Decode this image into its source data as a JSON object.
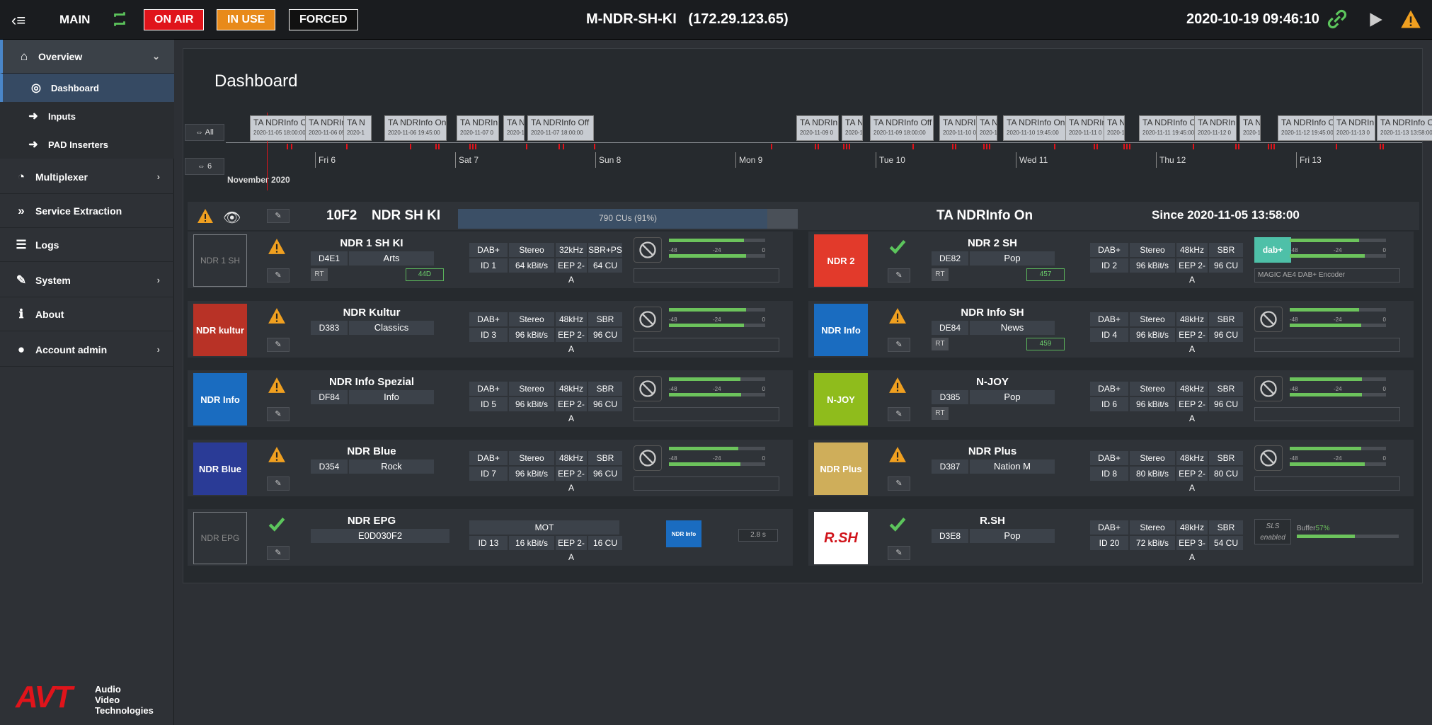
{
  "topbar": {
    "mode": "MAIN",
    "on_air": "ON AIR",
    "in_use": "IN USE",
    "forced": "FORCED",
    "host": "M-NDR-SH-KI   (172.29.123.65)",
    "datetime": "2020-10-19 09:46:10",
    "icons": [
      "menu-icon",
      "sync-icon",
      "link-icon",
      "play-icon",
      "warning-icon"
    ]
  },
  "sidebar": {
    "overview": "Overview",
    "dashboard": "Dashboard",
    "inputs": "Inputs",
    "pad": "PAD Inserters",
    "multiplexer": "Multiplexer",
    "service_extraction": "Service Extraction",
    "logs": "Logs",
    "system": "System",
    "about": "About",
    "account": "Account admin"
  },
  "logo": {
    "avt": "AVT",
    "line1": "Audio",
    "line2": "Video",
    "line3": "Technologies"
  },
  "dashboard": {
    "title": "Dashboard"
  },
  "timeline": {
    "all": "All",
    "six": "6",
    "month": "November 2020",
    "days": [
      "Fri 6",
      "Sat 7",
      "Sun 8",
      "Mon 9",
      "Tue 10",
      "Wed 11",
      "Thu 12",
      "Fri 13"
    ],
    "events": [
      {
        "t": "TA NDRInfo Off",
        "d": "2020-11-05 18:00:00"
      },
      {
        "t": "TA NDRInfo",
        "d": "2020-11-06 05:"
      },
      {
        "t": "TA N",
        "d": "2020-1"
      },
      {
        "t": "TA NDRInfo On",
        "d": "2020-11-06 19:45:00"
      },
      {
        "t": "TA NDRIn",
        "d": "2020-11-07 0"
      },
      {
        "t": "TA N",
        "d": "2020-1"
      },
      {
        "t": "TA NDRInfo Off",
        "d": "2020-11-07 18:00:00"
      },
      {
        "t": "TA NDRIn",
        "d": "2020-11-09 0"
      },
      {
        "t": "TA N",
        "d": "2020-1"
      },
      {
        "t": "TA NDRInfo Off",
        "d": "2020-11-09 18:00:00"
      },
      {
        "t": "TA NDRIn",
        "d": "2020-11-10 0"
      },
      {
        "t": "TA N",
        "d": "2020-1"
      },
      {
        "t": "TA NDRInfo On",
        "d": "2020-11-10 19:45:00"
      },
      {
        "t": "TA NDRIn",
        "d": "2020-11-11 0"
      },
      {
        "t": "TA N",
        "d": "2020-1"
      },
      {
        "t": "TA NDRInfo On",
        "d": "2020-11-11 19:45:00"
      },
      {
        "t": "TA NDRIn",
        "d": "2020-11-12 0"
      },
      {
        "t": "TA N",
        "d": "2020-1"
      },
      {
        "t": "TA NDRInfo On",
        "d": "2020-11-12 19:45:00"
      },
      {
        "t": "TA NDRIn",
        "d": "2020-11-13 0"
      },
      {
        "t": "TA NDRInfo On",
        "d": "2020-11-13 13:58:00"
      }
    ]
  },
  "ensemble": {
    "id": "10F2",
    "name": "NDR SH KI",
    "cu_label": "790 CUs (91%)",
    "cu_fraction": 0.91,
    "ta": "TA NDRInfo On",
    "since": "Since 2020-11-05 13:58:00"
  },
  "services": [
    {
      "logo": "NDR 1 SH",
      "name": "NDR 1 SH KI",
      "sid": "D4E1",
      "pty": "Arts",
      "rt": "RT",
      "pi": "44D",
      "c": [
        "DAB+",
        "Stereo",
        "32kHz",
        "SBR+PS",
        "ID 1",
        "64 kBit/s",
        "EEP 2-A",
        "64 CU"
      ],
      "txt": "",
      "ok": false
    },
    {
      "logo": "NDR 2",
      "name": "NDR 2 SH",
      "sid": "DE82",
      "pty": "Pop",
      "rt": "RT",
      "pi": "457",
      "c": [
        "DAB+",
        "Stereo",
        "48kHz",
        "SBR",
        "ID 2",
        "96 kBit/s",
        "EEP 2-A",
        "96 CU"
      ],
      "txt": "MAGIC AE4 DAB+ Encoder",
      "ok": true
    },
    {
      "logo": "NDR kultur",
      "name": "NDR Kultur",
      "sid": "D383",
      "pty": "Classics",
      "rt": "",
      "pi": "",
      "c": [
        "DAB+",
        "Stereo",
        "48kHz",
        "SBR",
        "ID 3",
        "96 kBit/s",
        "EEP 2-A",
        "96 CU"
      ],
      "txt": "",
      "ok": false
    },
    {
      "logo": "NDR Info",
      "name": "NDR Info SH",
      "sid": "DE84",
      "pty": "News",
      "rt": "RT",
      "pi": "459",
      "c": [
        "DAB+",
        "Stereo",
        "48kHz",
        "SBR",
        "ID 4",
        "96 kBit/s",
        "EEP 2-A",
        "96 CU"
      ],
      "txt": "",
      "ok": false
    },
    {
      "logo": "NDR Info",
      "name": "NDR Info Spezial",
      "sid": "DF84",
      "pty": "Info",
      "rt": "",
      "pi": "",
      "c": [
        "DAB+",
        "Stereo",
        "48kHz",
        "SBR",
        "ID 5",
        "96 kBit/s",
        "EEP 2-A",
        "96 CU"
      ],
      "txt": "",
      "ok": false
    },
    {
      "logo": "N-JOY",
      "name": "N-JOY",
      "sid": "D385",
      "pty": "Pop",
      "rt": "RT",
      "pi": "",
      "c": [
        "DAB+",
        "Stereo",
        "48kHz",
        "SBR",
        "ID 6",
        "96 kBit/s",
        "EEP 2-A",
        "96 CU"
      ],
      "txt": "",
      "ok": false
    },
    {
      "logo": "NDR Blue",
      "name": "NDR Blue",
      "sid": "D354",
      "pty": "Rock",
      "rt": "",
      "pi": "",
      "c": [
        "DAB+",
        "Stereo",
        "48kHz",
        "SBR",
        "ID 7",
        "96 kBit/s",
        "EEP 2-A",
        "96 CU"
      ],
      "txt": "",
      "ok": false
    },
    {
      "logo": "NDR Plus",
      "name": "NDR Plus",
      "sid": "D387",
      "pty": "Nation M",
      "rt": "",
      "pi": "",
      "c": [
        "DAB+",
        "Stereo",
        "48kHz",
        "SBR",
        "ID 8",
        "80 kBit/s",
        "EEP 2-A",
        "80 CU"
      ],
      "txt": "",
      "ok": false
    },
    {
      "logo": "NDR EPG",
      "name": "NDR EPG",
      "sid": "E0D030F2",
      "pty": "",
      "rt": "",
      "pi": "",
      "c": [
        "MOT",
        "ID 13",
        "16 kBit/s",
        "EEP 2-A",
        "16 CU"
      ],
      "txt": "2.8 s",
      "ok": true
    },
    {
      "logo": "R.SH",
      "name": "R.SH",
      "sid": "D3E8",
      "pty": "Pop",
      "rt": "",
      "pi": "",
      "c": [
        "DAB+",
        "Stereo",
        "48kHz",
        "SBR",
        "ID 20",
        "72 kBit/s",
        "EEP 3-A",
        "54 CU"
      ],
      "txt": "Buffer 57%",
      "ok": true
    }
  ],
  "meter_scale": [
    "-48",
    "-24",
    "0"
  ],
  "sls": "SLS enabled",
  "buffer": {
    "label": "Buffer",
    "value": "57%",
    "fraction": 0.57
  },
  "colors": {
    "on_air": "#e0141b",
    "in_use": "#e88a1a",
    "ok": "#5cc55c",
    "warn": "#f0a020",
    "accent": "#4a86c8"
  }
}
